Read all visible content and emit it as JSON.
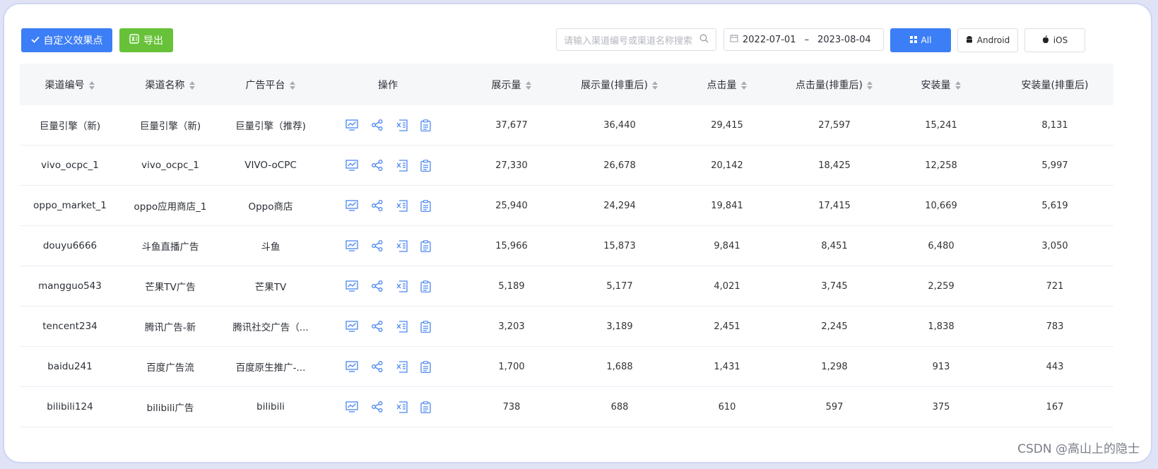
{
  "toolbar": {
    "custom_button": "自定义效果点",
    "export_button": "导出",
    "search_placeholder": "请输入渠道编号或渠道名称搜索",
    "date_start": "2022-07-01",
    "date_sep": "–",
    "date_end": "2023-08-04",
    "platforms": [
      "All",
      "Android",
      "iOS"
    ],
    "selected_platform": "All"
  },
  "table": {
    "headers": [
      "渠道编号",
      "渠道名称",
      "广告平台",
      "操作",
      "展示量",
      "展示量(排重后)",
      "点击量",
      "点击量(排重后)",
      "安装量",
      "安装量(排重后)"
    ],
    "op_icons": [
      "monitor-chart-icon",
      "share-icon",
      "excel-export-icon",
      "clipboard-icon"
    ],
    "rows": [
      {
        "code": "巨量引擎（新)",
        "name": "巨量引擎（新)",
        "platform": "巨量引擎（推荐)",
        "impr": "37,677",
        "impr_u": "36,440",
        "click": "29,415",
        "click_u": "27,597",
        "install": "15,241",
        "install_u": "8,131"
      },
      {
        "code": "vivo_ocpc_1",
        "name": "vivo_ocpc_1",
        "platform": "VIVO-oCPC",
        "impr": "27,330",
        "impr_u": "26,678",
        "click": "20,142",
        "click_u": "18,425",
        "install": "12,258",
        "install_u": "5,997"
      },
      {
        "code": "oppo_market_1",
        "name": "oppo应用商店_1",
        "platform": "Oppo商店",
        "impr": "25,940",
        "impr_u": "24,294",
        "click": "19,841",
        "click_u": "17,415",
        "install": "10,669",
        "install_u": "5,619"
      },
      {
        "code": "douyu6666",
        "name": "斗鱼直播广告",
        "platform": "斗鱼",
        "impr": "15,966",
        "impr_u": "15,873",
        "click": "9,841",
        "click_u": "8,451",
        "install": "6,480",
        "install_u": "3,050"
      },
      {
        "code": "mangguo543",
        "name": "芒果TV广告",
        "platform": "芒果TV",
        "impr": "5,189",
        "impr_u": "5,177",
        "click": "4,021",
        "click_u": "3,745",
        "install": "2,259",
        "install_u": "721"
      },
      {
        "code": "tencent234",
        "name": "腾讯广告-新",
        "platform": "腾讯社交广告（...",
        "impr": "3,203",
        "impr_u": "3,189",
        "click": "2,451",
        "click_u": "2,245",
        "install": "1,838",
        "install_u": "783"
      },
      {
        "code": "baidu241",
        "name": "百度广告流",
        "platform": "百度原生推广-...",
        "impr": "1,700",
        "impr_u": "1,688",
        "click": "1,431",
        "click_u": "1,298",
        "install": "913",
        "install_u": "443"
      },
      {
        "code": "bilibili124",
        "name": "bilibili广告",
        "platform": "bilibili",
        "impr": "738",
        "impr_u": "688",
        "click": "610",
        "click_u": "597",
        "install": "375",
        "install_u": "167"
      }
    ]
  },
  "watermark": "CSDN @高山上的隐士",
  "colors": {
    "primary": "#3c7ef6",
    "success": "#67c23a",
    "icon": "#4a86f0"
  }
}
